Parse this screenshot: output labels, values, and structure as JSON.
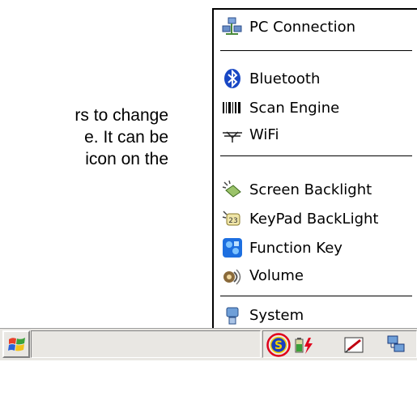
{
  "document": {
    "lines": [
      "rs to change",
      "e. It can be",
      "icon on the"
    ]
  },
  "menu": {
    "items": [
      {
        "label": "PC Connection",
        "icon": "pc-connection-icon"
      },
      {
        "label": "Bluetooth",
        "icon": "bluetooth-icon"
      },
      {
        "label": "Scan Engine",
        "icon": "barcode-icon"
      },
      {
        "label": "WiFi",
        "icon": "wifi-icon"
      },
      {
        "label": "Screen Backlight",
        "icon": "screen-backlight-icon"
      },
      {
        "label": "KeyPad BackLight",
        "icon": "keypad-backlight-icon"
      },
      {
        "label": "Function Key",
        "icon": "function-key-icon"
      },
      {
        "label": "Volume",
        "icon": "volume-icon"
      },
      {
        "label": "System",
        "icon": "system-icon"
      }
    ]
  },
  "taskbar": {
    "start_icon": "windows-flag-icon",
    "tray_icons": [
      "settings-s-icon",
      "battery-power-icon",
      "input-panel-icon",
      "connectivity-icon"
    ],
    "highlight_color": "#e0001b",
    "s_icon_color": "#1a3fbf"
  }
}
